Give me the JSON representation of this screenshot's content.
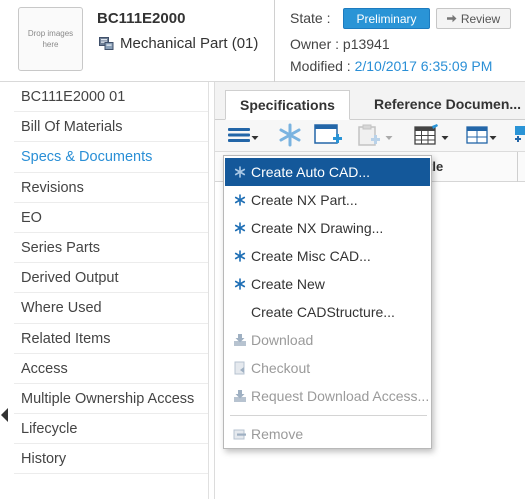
{
  "header": {
    "drop_images": "Drop images here",
    "part_number": "BC111E2000",
    "part_type": "Mechanical Part (01)",
    "state_label": "State :",
    "state_value": "Preliminary",
    "review_label": "Review",
    "owner": "Owner : p13941",
    "modified_label": "Modified :",
    "modified_value": "2/10/2017 6:35:09 PM"
  },
  "sidebar": {
    "items": [
      {
        "label": "BC111E2000 01"
      },
      {
        "label": "Bill Of Materials"
      },
      {
        "label": "Specs & Documents",
        "active": true
      },
      {
        "label": "Revisions"
      },
      {
        "label": "EO"
      },
      {
        "label": "Series Parts"
      },
      {
        "label": "Derived Output"
      },
      {
        "label": "Where Used"
      },
      {
        "label": "Related Items"
      },
      {
        "label": "Access"
      },
      {
        "label": "Multiple Ownership Access"
      },
      {
        "label": "Lifecycle"
      },
      {
        "label": "History"
      }
    ]
  },
  "tabs": [
    {
      "label": "Specifications",
      "active": true
    },
    {
      "label": "Reference Documen..."
    }
  ],
  "table": {
    "column_title": "tle"
  },
  "menu": {
    "items": [
      {
        "label": "Create Auto CAD...",
        "icon": "asterisk-icon",
        "highlight": true
      },
      {
        "label": "Create NX Part...",
        "icon": "asterisk-icon"
      },
      {
        "label": "Create NX Drawing...",
        "icon": "asterisk-icon"
      },
      {
        "label": "Create Misc CAD...",
        "icon": "asterisk-icon"
      },
      {
        "label": "Create New",
        "icon": "asterisk-icon"
      },
      {
        "label": "Create CADStructure..."
      },
      {
        "label": "Download",
        "icon": "download-icon",
        "disabled": true
      },
      {
        "label": "Checkout",
        "icon": "checkout-icon",
        "disabled": true
      },
      {
        "label": "Request Download Access...",
        "icon": "download-icon",
        "disabled": true
      },
      {
        "label": "Remove",
        "icon": "remove-icon",
        "disabled": true
      }
    ]
  },
  "colors": {
    "accent": "#2a8fd6",
    "menu_highlight": "#14589a",
    "state_button": "#2a94d6"
  }
}
